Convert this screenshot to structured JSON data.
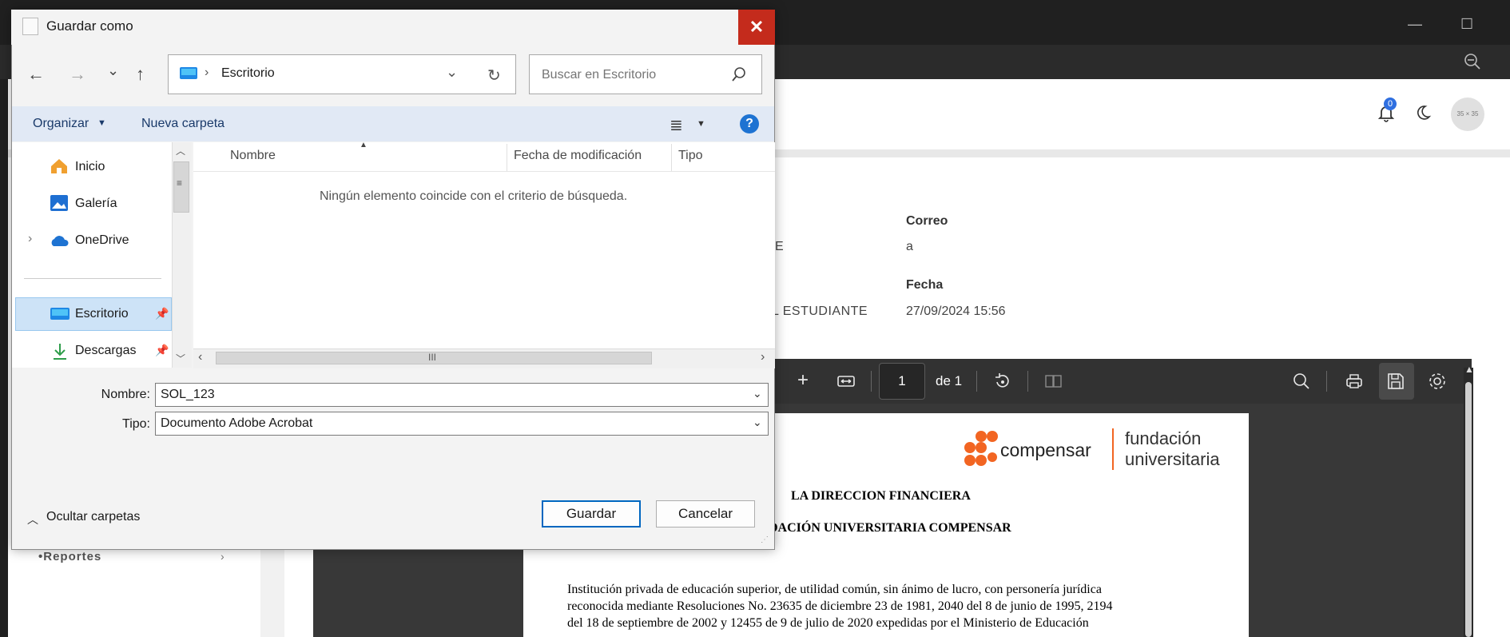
{
  "dialog": {
    "title": "Guardar como",
    "close_glyph": "✕",
    "nav": {
      "back": "←",
      "forward": "→",
      "recent": "⌄",
      "up": "↑"
    },
    "address": {
      "separator": "›",
      "location": "Escritorio",
      "dropdown": "⌄",
      "refresh": "↻"
    },
    "search": {
      "placeholder": "Buscar en Escritorio"
    },
    "toolbar": {
      "organize": "Organizar",
      "new_folder": "Nueva carpeta",
      "help": "?"
    },
    "navpane": {
      "items": [
        {
          "label": "Inicio",
          "icon": "home-icon"
        },
        {
          "label": "Galería",
          "icon": "gallery-icon"
        },
        {
          "label": "OneDrive",
          "icon": "onedrive-icon"
        },
        {
          "label": "Escritorio",
          "icon": "desktop-icon",
          "selected": true
        },
        {
          "label": "Descargas",
          "icon": "download-icon"
        }
      ]
    },
    "columns": {
      "name": "Nombre",
      "modified": "Fecha de modificación",
      "type": "Tipo"
    },
    "empty_message": "Ningún elemento coincide con el criterio de búsqueda.",
    "filename": {
      "label": "Nombre:",
      "value": "SOL_123"
    },
    "filetype": {
      "label": "Tipo:",
      "value": "Documento Adobe Acrobat"
    },
    "hide_folders": "Ocultar carpetas",
    "buttons": {
      "save": "Guardar",
      "cancel": "Cancelar"
    }
  },
  "background": {
    "window_controls": {
      "minimize": "—",
      "maximize": "☐"
    },
    "notification_count": "0",
    "avatar_text": "35 × 35",
    "info": {
      "correo_label": "Correo",
      "correo_value": "a",
      "partial_left_1": "E",
      "fecha_label": "Fecha",
      "partial_left_2": "L ESTUDIANTE",
      "fecha_value": "27/09/2024 15:56"
    },
    "sidebar": {
      "reportes": "•Reportes"
    },
    "pdf": {
      "page_number": "1",
      "page_total": "de 1",
      "zoom_in": "+",
      "logo_brand": "compensar",
      "logo_line1": "fundación",
      "logo_line2": "universitaria",
      "heading1": "LA DIRECCION FINANCIERA",
      "heading2": "DACIÓN UNIVERSITARIA COMPENSAR",
      "body_line1": "Institución privada de educación superior, de utilidad común, sin ánimo de lucro, con personería jurídica",
      "body_line2": "reconocida mediante Resoluciones No. 23635 de diciembre 23 de 1981, 2040 del 8 de junio de 1995, 2194",
      "body_line3": "del 18 de septiembre de 2002 y 12455 de 9 de julio de 2020 expedidas por el Ministerio de Educación"
    }
  },
  "colors": {
    "accent": "#0067c0",
    "close_red": "#c42b1c",
    "logo_orange": "#f26522"
  }
}
